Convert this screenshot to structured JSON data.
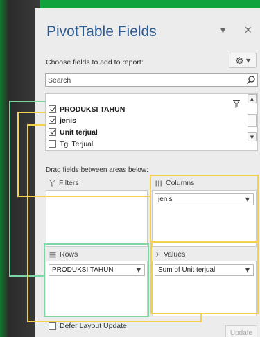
{
  "panel": {
    "title": "PivotTable Fields",
    "dropdown_glyph": "▾",
    "close_glyph": "✕",
    "subtitle": "Choose fields to add to report:",
    "tools_icon": "gear-icon"
  },
  "search": {
    "placeholder": "Search"
  },
  "fields": [
    {
      "label": "PRODUKSI TAHUN",
      "checked": true,
      "bold": true
    },
    {
      "label": "jenis",
      "checked": true,
      "bold": true
    },
    {
      "label": "Unit terjual",
      "checked": true,
      "bold": true
    },
    {
      "label": "Tgl Terjual",
      "checked": false,
      "bold": false
    }
  ],
  "areas": {
    "instruction": "Drag fields between areas below:",
    "filters": {
      "label": "Filters",
      "items": []
    },
    "columns": {
      "label": "Columns",
      "items": [
        "jenis"
      ]
    },
    "rows": {
      "label": "Rows",
      "items": [
        "PRODUKSI TAHUN"
      ]
    },
    "values": {
      "label": "Values",
      "items": [
        "Sum of Unit terjual"
      ]
    }
  },
  "footer": {
    "defer_label": "Defer Layout Update",
    "defer_checked": false,
    "update_label": "Update"
  },
  "colors": {
    "background_green": "#12a33c",
    "title_blue": "#2d5c93",
    "highlight_green": "#7cd6a2",
    "highlight_yellow": "#f2d24a"
  }
}
